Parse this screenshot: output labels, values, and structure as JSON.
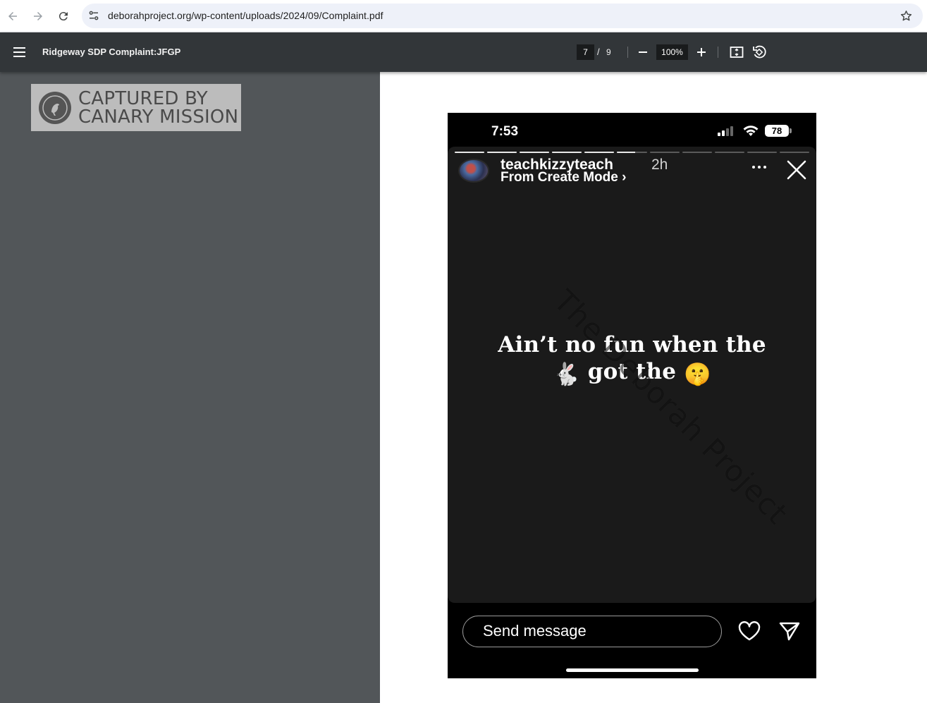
{
  "browser": {
    "url": "deborahproject.org/wp-content/uploads/2024/09/Complaint.pdf",
    "icons": {
      "back": "arrow-left-icon",
      "forward": "arrow-right-icon",
      "reload": "reload-icon",
      "site_info": "tune-icon",
      "bookmark": "star-icon"
    }
  },
  "pdf_toolbar": {
    "title": "Ridgeway SDP Complaint:JFGP",
    "current_page": "7",
    "separator": "/",
    "total_pages": "9",
    "zoom": "100%",
    "icons": {
      "menu": "hamburger-menu-icon",
      "zoom_out": "minus-icon",
      "zoom_in": "plus-icon",
      "fit": "fit-to-page-icon",
      "rotate": "rotate-icon"
    }
  },
  "stamp": {
    "line1": "CAPTURED BY",
    "line2": "CANARY MISSION"
  },
  "story": {
    "status_time": "7:53",
    "battery": "78",
    "progress_total": 11,
    "progress_viewed": 5,
    "progress_current_fraction": 0.6,
    "username": "teachkizzyteach",
    "age": "2h",
    "subtitle": "From Create Mode ›",
    "text_line1": "Ain’t no fun when the",
    "text_line2_emoji1": "🐇",
    "text_line2_words": "got the",
    "text_line2_emoji2": "🤫",
    "watermark": "The Deborah Project",
    "message_placeholder": "Send message"
  },
  "colors": {
    "browser_bg": "#ffffff",
    "omnibox_bg": "#eef1f9",
    "pdf_toolbar_bg": "#323639",
    "viewer_bg": "#525659",
    "story_bg": "#1a1a1a"
  }
}
